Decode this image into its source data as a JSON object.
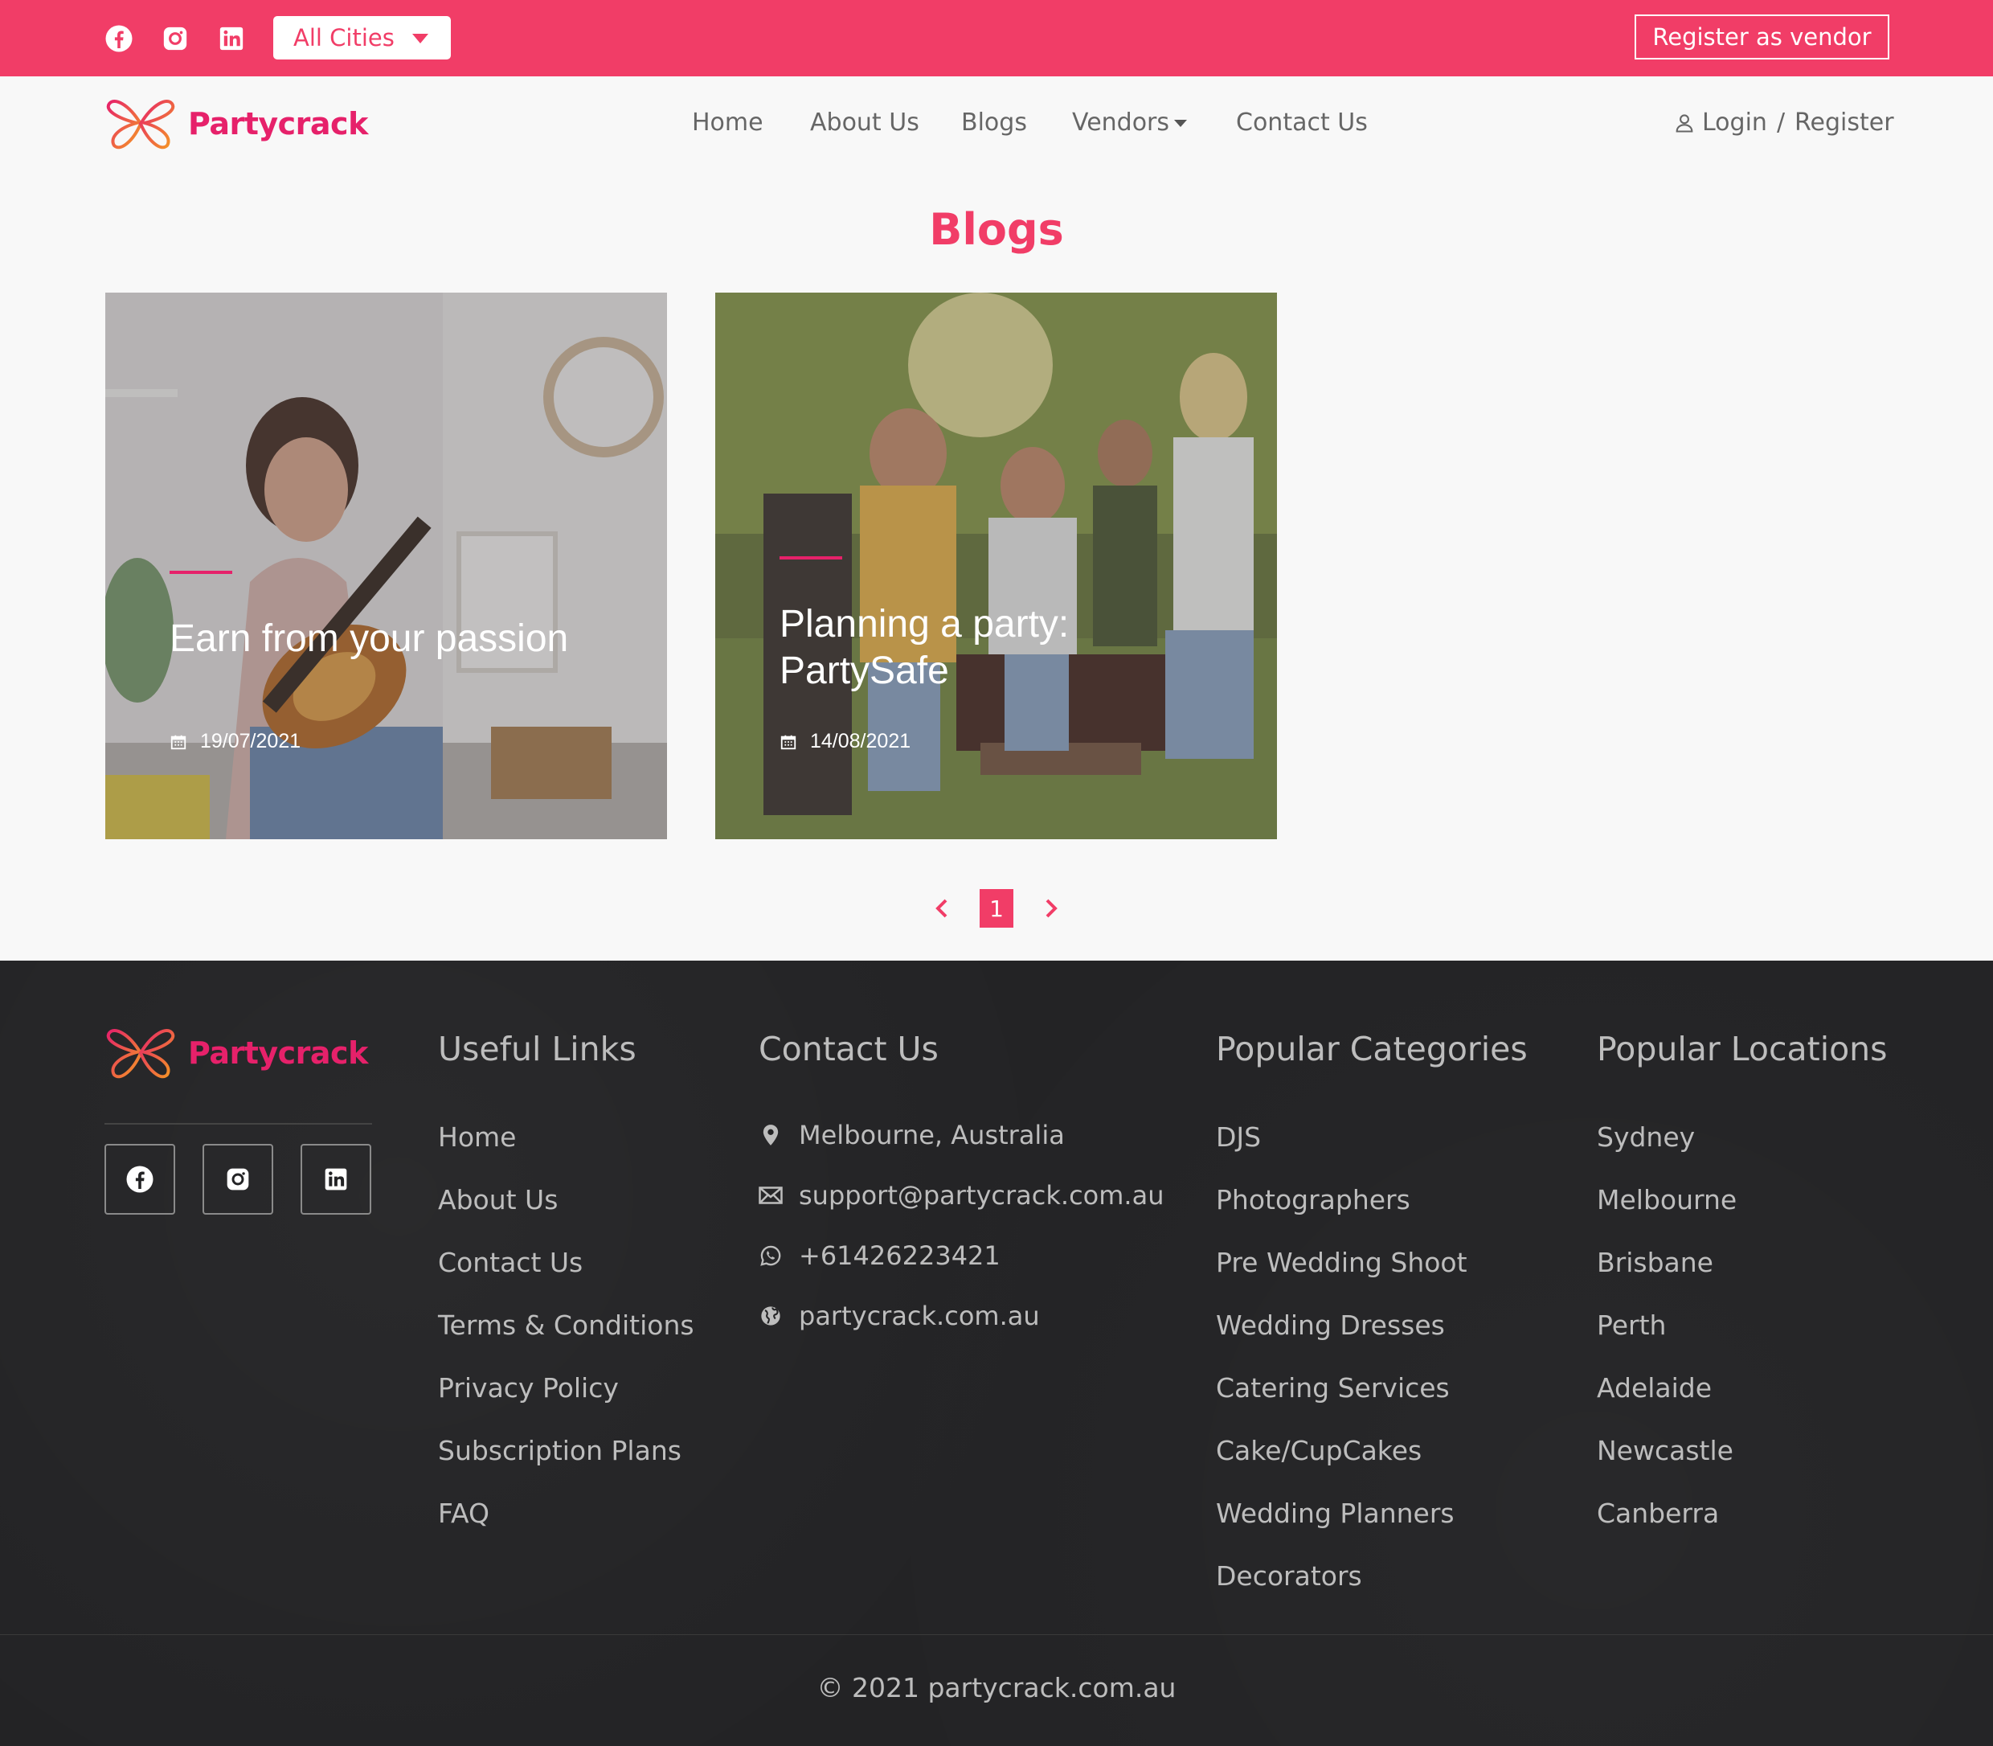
{
  "topbar": {
    "city_select": "All Cities",
    "vendor_button": "Register as vendor"
  },
  "nav": {
    "brand": "Partycrack",
    "links": [
      "Home",
      "About Us",
      "Blogs",
      "Vendors",
      "Contact Us"
    ],
    "login": "Login",
    "separator": "/",
    "register": "Register"
  },
  "blogs": {
    "title": "Blogs",
    "posts": [
      {
        "title": "Earn from your passion",
        "date": "19/07/2021"
      },
      {
        "title": "Planning a party: PartySafe",
        "date": "14/08/2021"
      }
    ],
    "pagination": {
      "current": "1"
    }
  },
  "footer": {
    "brand": "Partycrack",
    "useful_links": {
      "heading": "Useful Links",
      "items": [
        "Home",
        "About Us",
        "Contact Us",
        "Terms & Conditions",
        "Privacy Policy",
        "Subscription Plans",
        "FAQ"
      ]
    },
    "contact": {
      "heading": "Contact Us",
      "address": "Melbourne, Australia",
      "email": "support@partycrack.com.au",
      "phone": "+61426223421",
      "website": "partycrack.com.au"
    },
    "categories": {
      "heading": "Popular Categories",
      "items": [
        "DJS",
        "Photographers",
        "Pre Wedding Shoot",
        "Wedding Dresses",
        "Catering Services",
        "Cake/CupCakes",
        "Wedding Planners",
        "Decorators"
      ]
    },
    "locations": {
      "heading": "Popular Locations",
      "items": [
        "Sydney",
        "Melbourne",
        "Brisbane",
        "Perth",
        "Adelaide",
        "Newcastle",
        "Canberra"
      ]
    },
    "copyright": "© 2021 partycrack.com.au"
  },
  "colors": {
    "brand_pink": "#f13d67",
    "footer_bg": "#232325"
  }
}
